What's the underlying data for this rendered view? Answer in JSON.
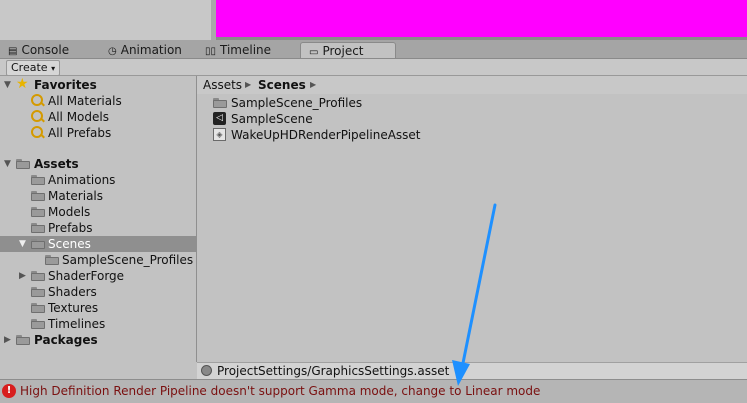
{
  "tabs": [
    {
      "label": "Console",
      "icon": "console-icon"
    },
    {
      "label": "Animation",
      "icon": "animation-icon"
    },
    {
      "label": "Timeline",
      "icon": "timeline-icon"
    },
    {
      "label": "Project",
      "icon": "folder-icon"
    }
  ],
  "toolbar": {
    "create_label": "Create",
    "create_arrow": "▾"
  },
  "favorites": {
    "label": "Favorites",
    "items": [
      "All Materials",
      "All Models",
      "All Prefabs"
    ]
  },
  "assets": {
    "label": "Assets",
    "items": [
      "Animations",
      "Materials",
      "Models",
      "Prefabs",
      "Scenes",
      "SampleScene_Profiles",
      "ShaderForge",
      "Shaders",
      "Textures",
      "Timelines"
    ]
  },
  "packages": {
    "label": "Packages"
  },
  "breadcrumb": {
    "root": "Assets",
    "current": "Scenes"
  },
  "folder_contents": [
    "SampleScene_Profiles",
    "SampleScene",
    "WakeUpHDRenderPipelineAsset"
  ],
  "path_bar": {
    "path": "ProjectSettings/GraphicsSettings.asset"
  },
  "status": {
    "message": "High Definition Render Pipeline doesn't support Gamma mode, change to Linear mode"
  },
  "colors": {
    "scene_view": "#ff00ff",
    "annotation_arrow": "#1e90ff",
    "error": "#d81e1e"
  }
}
